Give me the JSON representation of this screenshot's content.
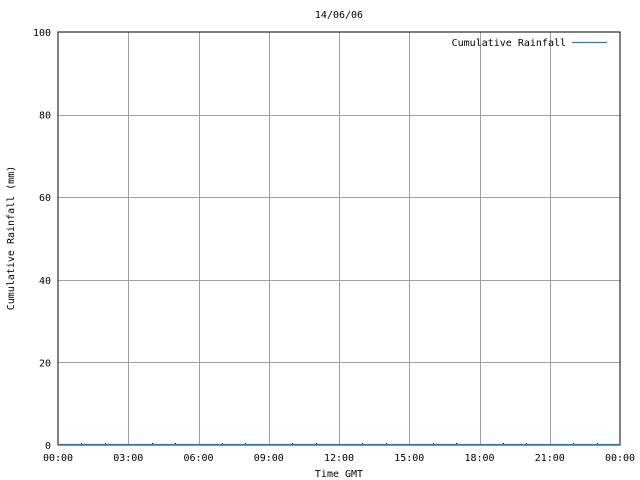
{
  "chart_data": {
    "type": "line",
    "title": "14/06/06",
    "xlabel": "Time GMT",
    "ylabel": "Cumulative Rainfall (mm)",
    "x_ticks": [
      "00:00",
      "03:00",
      "06:00",
      "09:00",
      "12:00",
      "15:00",
      "18:00",
      "21:00",
      "00:00"
    ],
    "y_ticks": [
      0,
      20,
      40,
      60,
      80,
      100
    ],
    "ylim": [
      0,
      100
    ],
    "xlim_hours": [
      0,
      24
    ],
    "grid": true,
    "legend_position": "top-right",
    "series": [
      {
        "name": "Cumulative Rainfall",
        "color": "#1a7fc4",
        "x_hours": [
          0,
          24
        ],
        "values": [
          0,
          0
        ]
      }
    ]
  }
}
